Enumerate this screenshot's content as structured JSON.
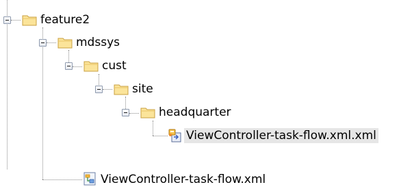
{
  "tree": {
    "nodes": [
      {
        "label": "feature2",
        "icon": "folder-icon",
        "expanded": true
      },
      {
        "label": "mdssys",
        "icon": "folder-icon",
        "expanded": true
      },
      {
        "label": "cust",
        "icon": "folder-icon",
        "expanded": true
      },
      {
        "label": "site",
        "icon": "folder-icon",
        "expanded": true
      },
      {
        "label": "headquarter",
        "icon": "folder-icon",
        "expanded": true
      },
      {
        "label": "ViewController-task-flow.xml.xml",
        "icon": "task-flow-customization-file-icon",
        "selected": true
      },
      {
        "label": "ViewController-task-flow.xml",
        "icon": "task-flow-file-icon"
      }
    ]
  },
  "colors": {
    "folder_fill": "#fbe49a",
    "folder_border": "#c9a042",
    "selection_bg": "#e6e6e6",
    "connector": "#8a8a8a"
  }
}
